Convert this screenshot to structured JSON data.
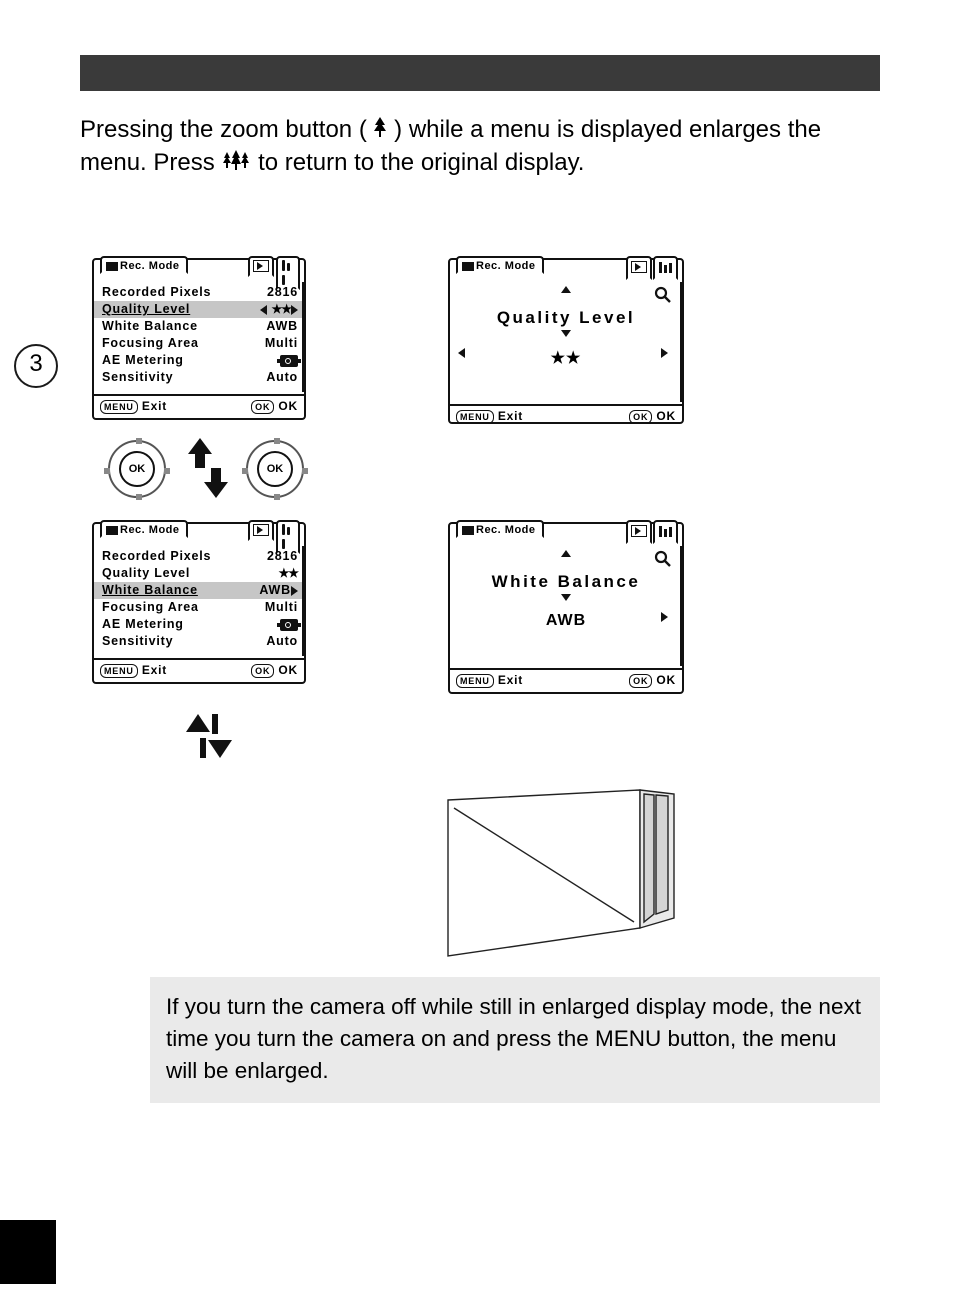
{
  "section_number": "3",
  "intro_text_a": "Pressing the zoom button ( ",
  "intro_text_b": " ) while a menu is displayed enlarges the menu. Press ",
  "intro_text_c": " to return to the original display.",
  "lcd_left": {
    "tab_label": "Rec. Mode",
    "rows": [
      {
        "label": "Recorded Pixels",
        "value": "2816"
      },
      {
        "label": "Quality Level",
        "value": "★★",
        "highlight": true,
        "arrows": true
      },
      {
        "label": "White Balance",
        "value": "AWB"
      },
      {
        "label": "Focusing Area",
        "value": "Multi"
      },
      {
        "label": "AE Metering",
        "value": "icon"
      },
      {
        "label": "Sensitivity",
        "value": "Auto"
      }
    ],
    "foot_exit": "Exit",
    "foot_ok": "OK",
    "menu_pill": "MENU",
    "ok_pill": "OK"
  },
  "lcd_left2": {
    "tab_label": "Rec. Mode",
    "rows": [
      {
        "label": "Recorded Pixels",
        "value": "2816"
      },
      {
        "label": "Quality Level",
        "value": "★★"
      },
      {
        "label": "White Balance",
        "value": "AWB",
        "highlight": true,
        "right_arrow": true
      },
      {
        "label": "Focusing Area",
        "value": "Multi"
      },
      {
        "label": "AE Metering",
        "value": "icon"
      },
      {
        "label": "Sensitivity",
        "value": "Auto"
      }
    ],
    "foot_exit": "Exit",
    "foot_ok": "OK",
    "menu_pill": "MENU",
    "ok_pill": "OK"
  },
  "elcd_top": {
    "tab_label": "Rec. Mode",
    "title": "Quality Level",
    "value": "★★",
    "foot_exit": "Exit",
    "foot_ok": "OK",
    "menu_pill": "MENU",
    "ok_pill": "OK"
  },
  "elcd_bottom": {
    "tab_label": "Rec. Mode",
    "title": "White Balance",
    "value": "AWB",
    "foot_exit": "Exit",
    "foot_ok": "OK",
    "menu_pill": "MENU",
    "ok_pill": "OK"
  },
  "dial_label": "OK",
  "note_text": "If you turn the camera off while still in enlarged display mode, the next time you turn the camera on and press the MENU button, the menu will be enlarged."
}
